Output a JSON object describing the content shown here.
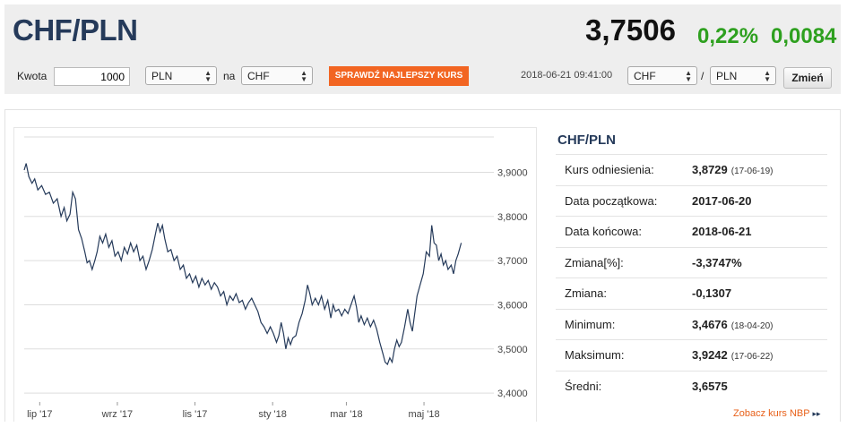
{
  "header": {
    "pair": "CHF/PLN",
    "rate": "3,7506",
    "change_pct": "0,22%",
    "change_abs": "0,0084"
  },
  "converter": {
    "amount_label": "Kwota",
    "amount_value": "1000",
    "from_currency": "PLN",
    "on_label": "na",
    "to_currency": "CHF",
    "best_rate_button": "SPRAWDŹ NAJLEPSZY KURS",
    "timestamp": "2018-06-21 09:41:00",
    "pair_base": "CHF",
    "slash": "/",
    "pair_quote": "PLN",
    "change_button": "Zmień"
  },
  "stats": {
    "title": "CHF/PLN",
    "rows": [
      {
        "label": "Kurs odniesienia:",
        "value": "3,8729",
        "date": "(17-06-19)"
      },
      {
        "label": "Data początkowa:",
        "value": "2017-06-20",
        "date": ""
      },
      {
        "label": "Data końcowa:",
        "value": "2018-06-21",
        "date": ""
      },
      {
        "label": "Zmiana[%]:",
        "value": "-3,3747%",
        "date": ""
      },
      {
        "label": "Zmiana:",
        "value": "-0,1307",
        "date": ""
      },
      {
        "label": "Minimum:",
        "value": "3,4676",
        "date": "(18-04-20)"
      },
      {
        "label": "Maksimum:",
        "value": "3,9242",
        "date": "(17-06-22)"
      },
      {
        "label": "Średni:",
        "value": "3,6575",
        "date": ""
      }
    ],
    "nbp_link": "Zobacz kurs NBP",
    "nbp_arrow": "▸▸"
  },
  "chart_data": {
    "type": "line",
    "x_tick_labels": [
      "lip '17",
      "wrz '17",
      "lis '17",
      "sty '18",
      "mar '18",
      "maj '18"
    ],
    "x_tick_months": [
      0.4,
      2.4,
      4.4,
      6.4,
      8.3,
      10.3
    ],
    "y_tick_labels": [
      "3,9000",
      "3,8000",
      "3,7000",
      "3,6000",
      "3,5000",
      "3,4000"
    ],
    "y_ticks": [
      3.9,
      3.8,
      3.7,
      3.6,
      3.5,
      3.4
    ],
    "ylim": [
      3.38,
      3.98
    ],
    "xlim": [
      0,
      12.1
    ],
    "grid": true,
    "line_color": "#253a5a",
    "series": [
      {
        "values": [
          [
            0.0,
            3.905
          ],
          [
            0.05,
            3.92
          ],
          [
            0.12,
            3.89
          ],
          [
            0.2,
            3.875
          ],
          [
            0.27,
            3.885
          ],
          [
            0.35,
            3.86
          ],
          [
            0.45,
            3.87
          ],
          [
            0.55,
            3.85
          ],
          [
            0.65,
            3.855
          ],
          [
            0.75,
            3.83
          ],
          [
            0.85,
            3.84
          ],
          [
            0.95,
            3.8
          ],
          [
            1.03,
            3.82
          ],
          [
            1.1,
            3.79
          ],
          [
            1.18,
            3.805
          ],
          [
            1.25,
            3.855
          ],
          [
            1.32,
            3.84
          ],
          [
            1.4,
            3.77
          ],
          [
            1.48,
            3.75
          ],
          [
            1.56,
            3.72
          ],
          [
            1.62,
            3.695
          ],
          [
            1.68,
            3.7
          ],
          [
            1.75,
            3.68
          ],
          [
            1.82,
            3.7
          ],
          [
            1.88,
            3.72
          ],
          [
            1.95,
            3.755
          ],
          [
            2.02,
            3.74
          ],
          [
            2.1,
            3.76
          ],
          [
            2.18,
            3.73
          ],
          [
            2.26,
            3.745
          ],
          [
            2.34,
            3.71
          ],
          [
            2.42,
            3.72
          ],
          [
            2.5,
            3.7
          ],
          [
            2.58,
            3.73
          ],
          [
            2.66,
            3.715
          ],
          [
            2.74,
            3.74
          ],
          [
            2.82,
            3.72
          ],
          [
            2.9,
            3.735
          ],
          [
            2.98,
            3.7
          ],
          [
            3.06,
            3.71
          ],
          [
            3.14,
            3.68
          ],
          [
            3.22,
            3.7
          ],
          [
            3.3,
            3.725
          ],
          [
            3.38,
            3.76
          ],
          [
            3.44,
            3.785
          ],
          [
            3.5,
            3.765
          ],
          [
            3.56,
            3.78
          ],
          [
            3.62,
            3.75
          ],
          [
            3.7,
            3.72
          ],
          [
            3.78,
            3.725
          ],
          [
            3.86,
            3.7
          ],
          [
            3.94,
            3.71
          ],
          [
            4.02,
            3.68
          ],
          [
            4.1,
            3.69
          ],
          [
            4.18,
            3.66
          ],
          [
            4.26,
            3.67
          ],
          [
            4.34,
            3.65
          ],
          [
            4.42,
            3.665
          ],
          [
            4.5,
            3.64
          ],
          [
            4.58,
            3.66
          ],
          [
            4.66,
            3.645
          ],
          [
            4.74,
            3.655
          ],
          [
            4.82,
            3.635
          ],
          [
            4.9,
            3.65
          ],
          [
            4.98,
            3.64
          ],
          [
            5.06,
            3.62
          ],
          [
            5.14,
            3.63
          ],
          [
            5.22,
            3.6
          ],
          [
            5.3,
            3.62
          ],
          [
            5.38,
            3.61
          ],
          [
            5.46,
            3.625
          ],
          [
            5.54,
            3.605
          ],
          [
            5.62,
            3.61
          ],
          [
            5.7,
            3.59
          ],
          [
            5.78,
            3.605
          ],
          [
            5.86,
            3.615
          ],
          [
            5.94,
            3.6
          ],
          [
            6.02,
            3.585
          ],
          [
            6.1,
            3.56
          ],
          [
            6.18,
            3.55
          ],
          [
            6.26,
            3.535
          ],
          [
            6.34,
            3.55
          ],
          [
            6.42,
            3.535
          ],
          [
            6.5,
            3.515
          ],
          [
            6.56,
            3.53
          ],
          [
            6.62,
            3.56
          ],
          [
            6.68,
            3.535
          ],
          [
            6.74,
            3.5
          ],
          [
            6.8,
            3.525
          ],
          [
            6.86,
            3.51
          ],
          [
            6.92,
            3.525
          ],
          [
            7.0,
            3.53
          ],
          [
            7.08,
            3.56
          ],
          [
            7.16,
            3.58
          ],
          [
            7.24,
            3.61
          ],
          [
            7.3,
            3.645
          ],
          [
            7.36,
            3.625
          ],
          [
            7.42,
            3.6
          ],
          [
            7.5,
            3.615
          ],
          [
            7.58,
            3.6
          ],
          [
            7.66,
            3.62
          ],
          [
            7.74,
            3.59
          ],
          [
            7.82,
            3.61
          ],
          [
            7.9,
            3.57
          ],
          [
            7.96,
            3.6
          ],
          [
            8.02,
            3.585
          ],
          [
            8.1,
            3.59
          ],
          [
            8.18,
            3.575
          ],
          [
            8.26,
            3.59
          ],
          [
            8.34,
            3.58
          ],
          [
            8.42,
            3.6
          ],
          [
            8.5,
            3.62
          ],
          [
            8.56,
            3.595
          ],
          [
            8.62,
            3.56
          ],
          [
            8.68,
            3.575
          ],
          [
            8.76,
            3.555
          ],
          [
            8.84,
            3.57
          ],
          [
            8.92,
            3.55
          ],
          [
            9.0,
            3.565
          ],
          [
            9.08,
            3.545
          ],
          [
            9.16,
            3.515
          ],
          [
            9.24,
            3.49
          ],
          [
            9.3,
            3.47
          ],
          [
            9.36,
            3.465
          ],
          [
            9.42,
            3.48
          ],
          [
            9.48,
            3.47
          ],
          [
            9.54,
            3.5
          ],
          [
            9.6,
            3.52
          ],
          [
            9.66,
            3.505
          ],
          [
            9.72,
            3.515
          ],
          [
            9.8,
            3.55
          ],
          [
            9.88,
            3.59
          ],
          [
            9.94,
            3.56
          ],
          [
            10.0,
            3.54
          ],
          [
            10.06,
            3.58
          ],
          [
            10.12,
            3.62
          ],
          [
            10.2,
            3.645
          ],
          [
            10.28,
            3.67
          ],
          [
            10.36,
            3.72
          ],
          [
            10.44,
            3.71
          ],
          [
            10.5,
            3.78
          ],
          [
            10.56,
            3.74
          ],
          [
            10.62,
            3.735
          ],
          [
            10.68,
            3.7
          ],
          [
            10.74,
            3.715
          ],
          [
            10.8,
            3.69
          ],
          [
            10.86,
            3.7
          ],
          [
            10.92,
            3.68
          ],
          [
            11.0,
            3.69
          ],
          [
            11.06,
            3.67
          ],
          [
            11.12,
            3.7
          ],
          [
            11.18,
            3.715
          ],
          [
            11.26,
            3.74
          ]
        ]
      }
    ]
  }
}
